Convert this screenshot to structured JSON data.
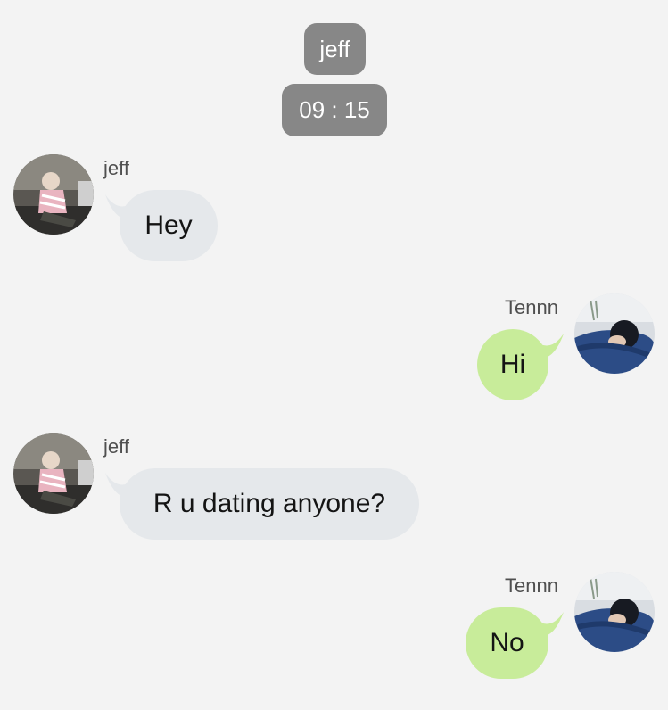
{
  "header": {
    "chat_name": "jeff",
    "time": "09 : 15"
  },
  "messages": [
    {
      "sender": "jeff",
      "text": "Hey",
      "side": "incoming",
      "avatar": "jeff-avatar"
    },
    {
      "sender": "Tennn",
      "text": "Hi",
      "side": "outgoing",
      "avatar": "tennn-avatar"
    },
    {
      "sender": "jeff",
      "text": "R u dating anyone?",
      "side": "incoming",
      "avatar": "jeff-avatar"
    },
    {
      "sender": "Tennn",
      "text": "No",
      "side": "outgoing",
      "avatar": "tennn-avatar"
    }
  ],
  "colors": {
    "background": "#f3f3f3",
    "header_pill": "#878787",
    "incoming_bubble": "#e5e8eb",
    "outgoing_bubble": "#c8ec9a"
  }
}
